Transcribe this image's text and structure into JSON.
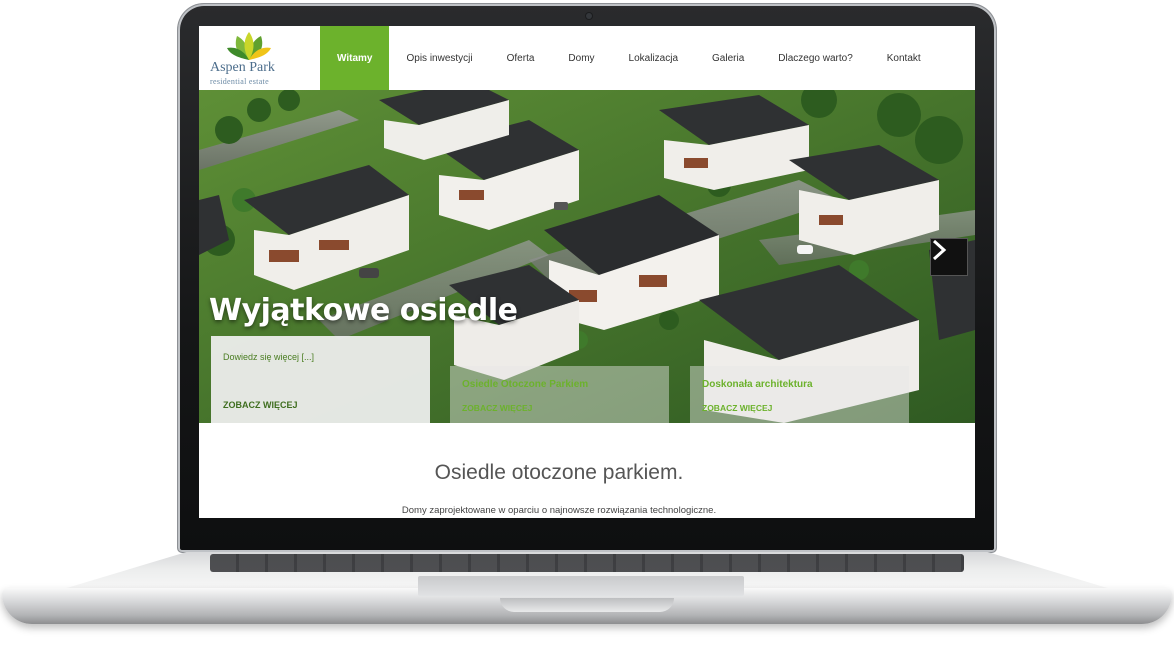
{
  "logo": {
    "name": "Aspen Park",
    "subtitle": "residential estate"
  },
  "nav": {
    "items": [
      {
        "label": "Witamy",
        "active": true
      },
      {
        "label": "Opis inwestycji",
        "active": false
      },
      {
        "label": "Oferta",
        "active": false
      },
      {
        "label": "Domy",
        "active": false
      },
      {
        "label": "Lokalizacja",
        "active": false
      },
      {
        "label": "Galeria",
        "active": false
      },
      {
        "label": "Dlaczego warto?",
        "active": false
      },
      {
        "label": "Kontakt",
        "active": false
      }
    ]
  },
  "hero": {
    "title": "Wyjątkowe osiedle",
    "next_icon": "chevron-right-icon",
    "cards": [
      {
        "title": "Dowiedz się więcej [...]",
        "link": "ZOBACZ WIĘCEJ"
      },
      {
        "title": "Osiedle Otoczone Parkiem",
        "link": "ZOBACZ WIĘCEJ"
      },
      {
        "title": "Doskonała architektura",
        "link": "ZOBACZ WIĘCEJ"
      }
    ]
  },
  "section": {
    "title": "Osiedle otoczone parkiem.",
    "text": "Domy zaprojektowane w oparciu o najnowsze rozwiązania technologiczne."
  },
  "colors": {
    "accent": "#6cb22c",
    "nav_text": "#333333"
  }
}
